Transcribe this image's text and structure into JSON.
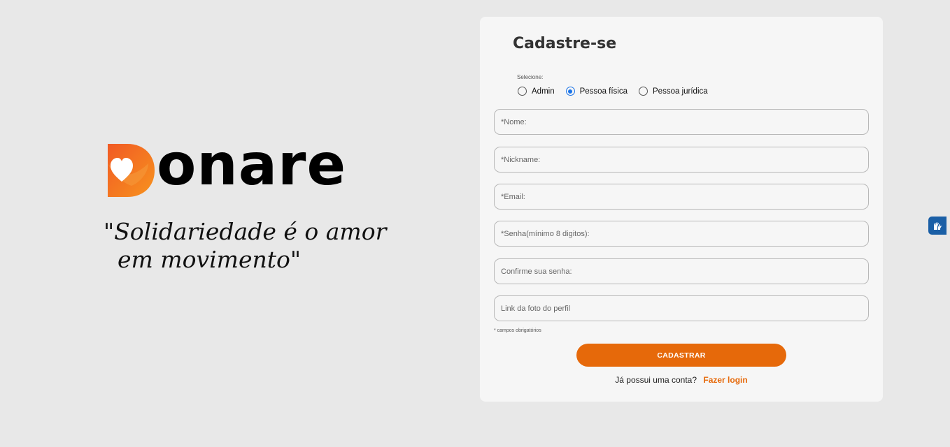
{
  "brand": {
    "logo_text": "onare",
    "slogan_line1": "\"Solidariedade é o amor",
    "slogan_line2": "em movimento\""
  },
  "form": {
    "title": "Cadastre-se",
    "select_label": "Selecione:",
    "radio_options": [
      {
        "label": "Admin",
        "checked": false
      },
      {
        "label": "Pessoa física",
        "checked": true
      },
      {
        "label": "Pessoa jurídica",
        "checked": false
      }
    ],
    "fields": {
      "nome_placeholder": "*Nome:",
      "nickname_placeholder": "*Nickname:",
      "email_placeholder": "*Email:",
      "senha_placeholder": "*Senha(mínimo 8 digitos):",
      "confirm_placeholder": "Confirme sua senha:",
      "foto_placeholder": "Link da foto do perfil"
    },
    "required_note": "* campos obrigatórios",
    "submit_label": "CADASTRAR",
    "login_prompt": "Já possui uma conta?",
    "login_link": "Fazer login"
  },
  "colors": {
    "accent": "#e6690a",
    "radio_selected": "#1a73e8",
    "background": "#e8e8e8",
    "card": "#f6f6f6"
  },
  "icons": {
    "accessibility_widget": "sign-language-hands-icon"
  }
}
